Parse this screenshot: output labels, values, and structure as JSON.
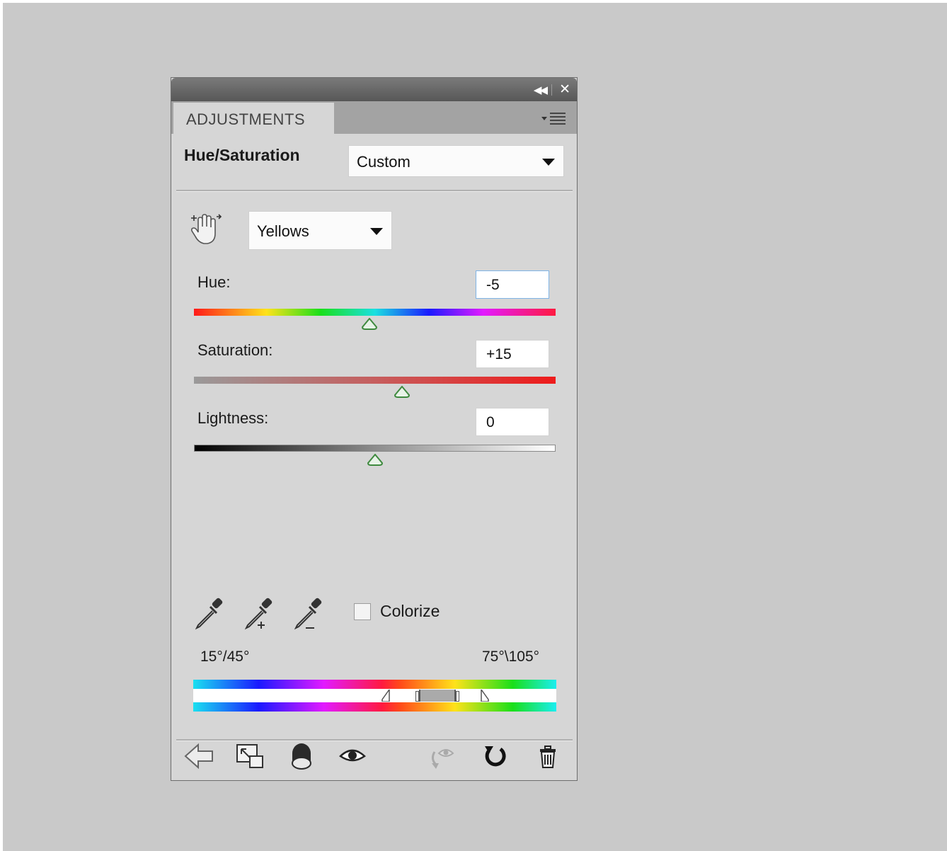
{
  "panel": {
    "tab_label": "ADJUSTMENTS",
    "adjustment_title": "Hue/Saturation",
    "preset": {
      "selected": "Custom"
    },
    "range": {
      "selected": "Yellows"
    },
    "sliders": {
      "hue": {
        "label": "Hue:",
        "value": "-5",
        "min": -180,
        "max": 180
      },
      "saturation": {
        "label": "Saturation:",
        "value": "+15",
        "min": -100,
        "max": 100
      },
      "lightness": {
        "label": "Lightness:",
        "value": "0",
        "min": -100,
        "max": 100
      }
    },
    "colorize": {
      "label": "Colorize",
      "checked": false
    },
    "range_degrees": {
      "left": "15°/45°",
      "right": "75°\\105°"
    }
  },
  "icons": {
    "titlebar": [
      "collapse-icon",
      "close-icon"
    ],
    "tab": [
      "panel-menu-icon"
    ],
    "tools": [
      "targeted-adjustment-hand-icon",
      "eyedropper-icon",
      "eyedropper-plus-icon",
      "eyedropper-minus-icon"
    ],
    "footer": [
      "back-arrow-icon",
      "expand-view-icon",
      "clip-to-layer-icon",
      "visibility-eye-icon",
      "view-previous-state-icon",
      "reset-icon",
      "trash-icon"
    ]
  },
  "colors": {
    "panel_bg": "#d6d6d6",
    "canvas_bg": "#c9c9c9",
    "thumb_green": "#3f8a3f"
  }
}
